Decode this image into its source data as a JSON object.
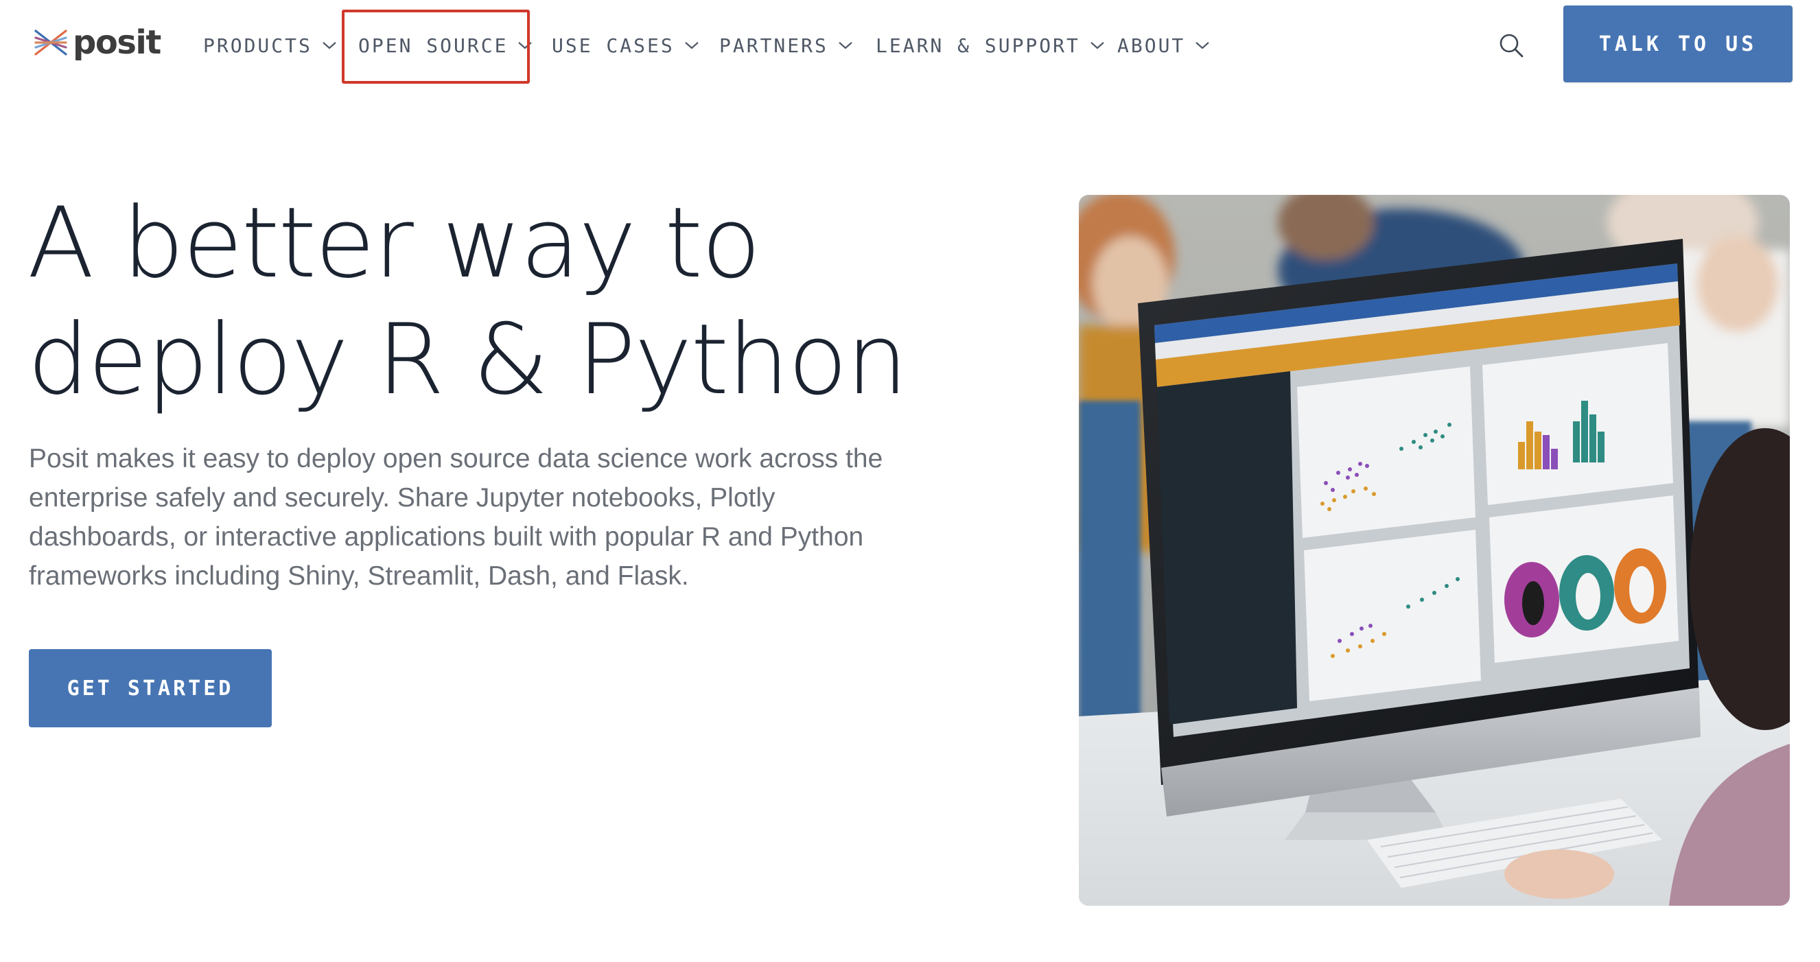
{
  "brand": {
    "name": "posit",
    "colors": {
      "primary": "#4775b3",
      "highlight": "#d0392b",
      "text": "#1b2331",
      "muted": "#6a6f77"
    }
  },
  "nav": {
    "items": [
      {
        "label": "PRODUCTS",
        "icon": "chevron-down-icon"
      },
      {
        "label": "OPEN SOURCE",
        "icon": "chevron-down-icon"
      },
      {
        "label": "USE CASES",
        "icon": "chevron-down-icon"
      },
      {
        "label": "PARTNERS",
        "icon": "chevron-down-icon"
      },
      {
        "label": "LEARN & SUPPORT",
        "icon": "chevron-down-icon"
      },
      {
        "label": "ABOUT",
        "icon": "chevron-down-icon"
      }
    ],
    "search_icon": "search-icon",
    "cta_label": "TALK TO US"
  },
  "hero": {
    "title_line1": "A better way to",
    "title_line2": "deploy R & Python",
    "body": "Posit makes it easy to deploy open source data science work across the enterprise safely and securely. Share Jupyter notebooks, Plotly dashboards, or interactive applications built with popular R and Python frameworks including Shiny, Streamlit, Dash, and Flask.",
    "cta_label": "GET STARTED"
  }
}
